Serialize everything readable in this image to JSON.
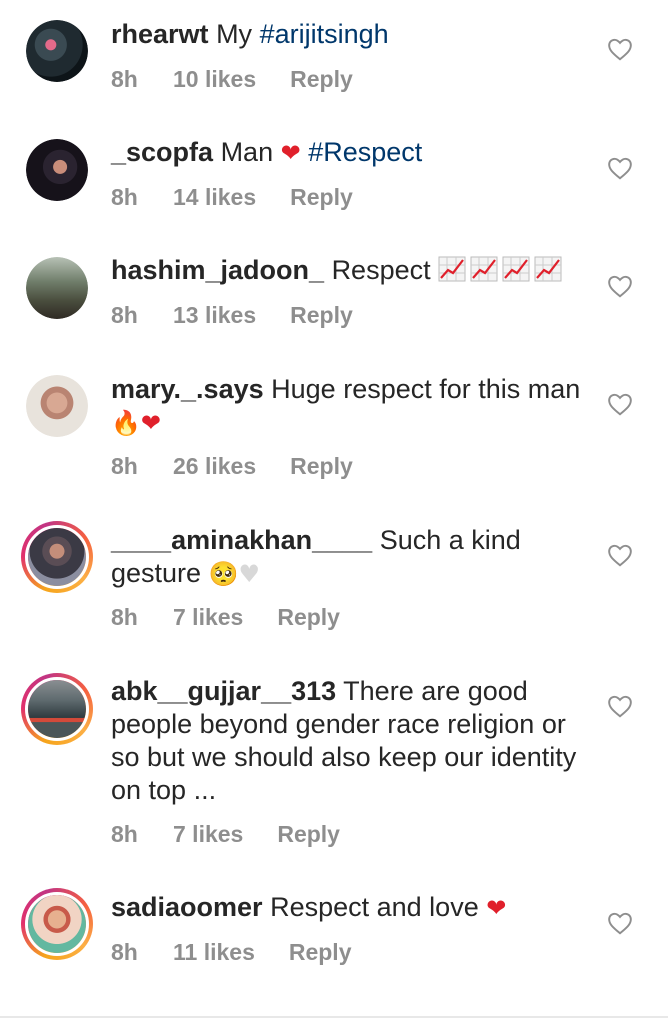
{
  "comments": [
    {
      "user": "rhearwt",
      "text": "My ",
      "tag": "#arijitsingh",
      "time": "8h",
      "likes": "10 likes",
      "reply": "Reply"
    },
    {
      "user": "_scopfa",
      "text": "Man ",
      "tag": "#Respect",
      "time": "8h",
      "likes": "14 likes",
      "reply": "Reply"
    },
    {
      "user": "hashim_jadoon_",
      "text": "Respect ",
      "time": "8h",
      "likes": "13 likes",
      "reply": "Reply"
    },
    {
      "user": "mary._.says",
      "text": "Huge respect for this man",
      "time": "8h",
      "likes": "26 likes",
      "reply": "Reply"
    },
    {
      "user": "____aminakhan____",
      "text": "Such a kind gesture ",
      "time": "8h",
      "likes": "7 likes",
      "reply": "Reply"
    },
    {
      "user": "abk__gujjar__313",
      "text": "There are good people beyond gender race religion or so but we should also keep our identity on top ...",
      "time": "8h",
      "likes": "7 likes",
      "reply": "Reply"
    },
    {
      "user": "sadiaoomer",
      "text": "Respect and love ",
      "time": "8h",
      "likes": "11 likes",
      "reply": "Reply"
    }
  ],
  "icons": {
    "like": "heart-outline-icon",
    "emoji_heart": "red-heart",
    "emoji_fire": "fire",
    "emoji_pleading": "pleading-face",
    "emoji_white_heart": "white-heart",
    "emoji_chart": "chart-increasing"
  },
  "colors": {
    "hashtag": "#00376b",
    "meta": "#8e8e8e",
    "heart": "#e0202b"
  }
}
